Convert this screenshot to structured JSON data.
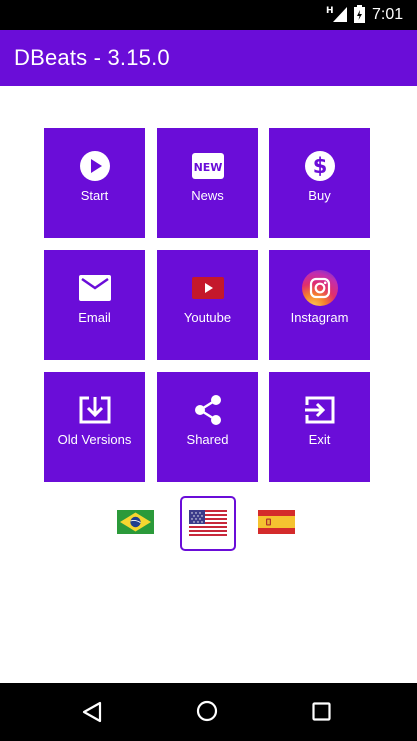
{
  "status_bar": {
    "network_type": "H",
    "time": "7:01"
  },
  "app_bar": {
    "title": "DBeats - 3.15.0"
  },
  "menu": {
    "tiles": [
      {
        "label": "Start",
        "icon": "play-icon"
      },
      {
        "label": "News",
        "icon": "new-badge-icon",
        "icon_text": "NEW"
      },
      {
        "label": "Buy",
        "icon": "dollar-icon"
      },
      {
        "label": "Email",
        "icon": "email-icon"
      },
      {
        "label": "Youtube",
        "icon": "youtube-icon"
      },
      {
        "label": "Instagram",
        "icon": "instagram-icon"
      },
      {
        "label": "Old Versions",
        "icon": "download-icon"
      },
      {
        "label": "Shared",
        "icon": "share-icon"
      },
      {
        "label": "Exit",
        "icon": "exit-icon"
      }
    ]
  },
  "languages": {
    "options": [
      "brazil-flag",
      "usa-flag",
      "spain-flag"
    ],
    "selected": "usa-flag"
  },
  "navigation": {
    "buttons": [
      "back-icon",
      "home-icon",
      "recents-icon"
    ]
  },
  "colors": {
    "primary": "#6a0dd8",
    "status_bar": "#000000",
    "nav_bar": "#000000",
    "background": "#ffffff"
  }
}
